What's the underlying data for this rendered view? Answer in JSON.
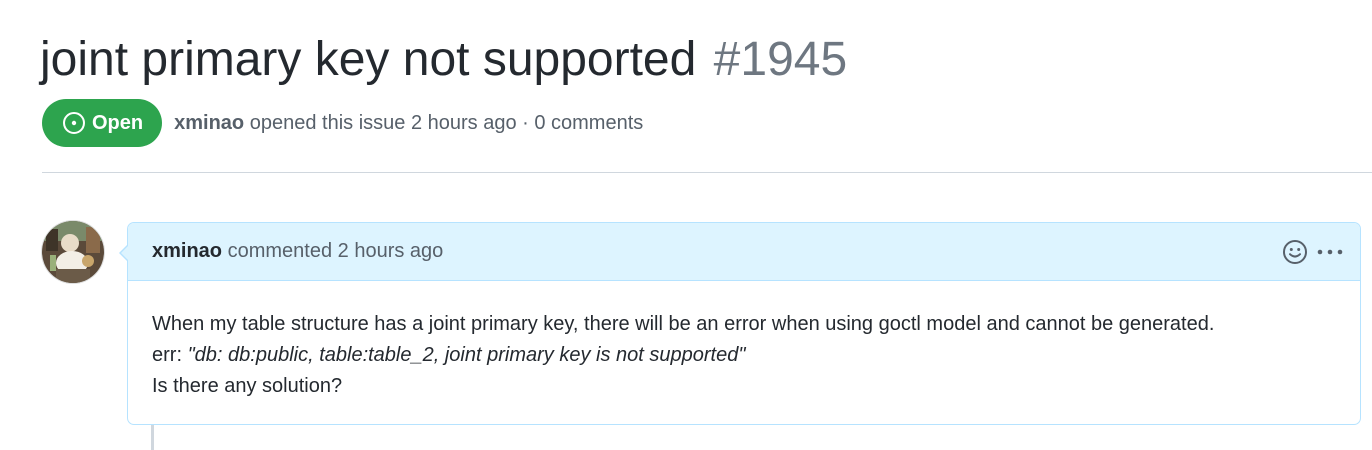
{
  "issue": {
    "title": "joint primary key not supported",
    "number": "#1945",
    "state": "Open",
    "state_color": "#2da44e",
    "author": "xminao",
    "meta_suffix": "opened this issue 2 hours ago · 0 comments"
  },
  "comment": {
    "author": "xminao",
    "header_suffix": "commented 2 hours ago",
    "body_line1": "When my table structure has a joint primary key, there will be an error when using goctl model and cannot be generated.",
    "body_line2_prefix": "err: ",
    "body_line2_quote": "\"db: db:public, table:table_2, joint primary key is not supported\"",
    "body_line3": "Is there any solution?",
    "header_color": "#ddf4ff",
    "border_color": "#b6e3ff"
  },
  "icons": {
    "state": "issue-opened-icon",
    "reaction": "smiley-icon",
    "more": "kebab-horizontal-icon",
    "avatar": "user-avatar-image"
  }
}
